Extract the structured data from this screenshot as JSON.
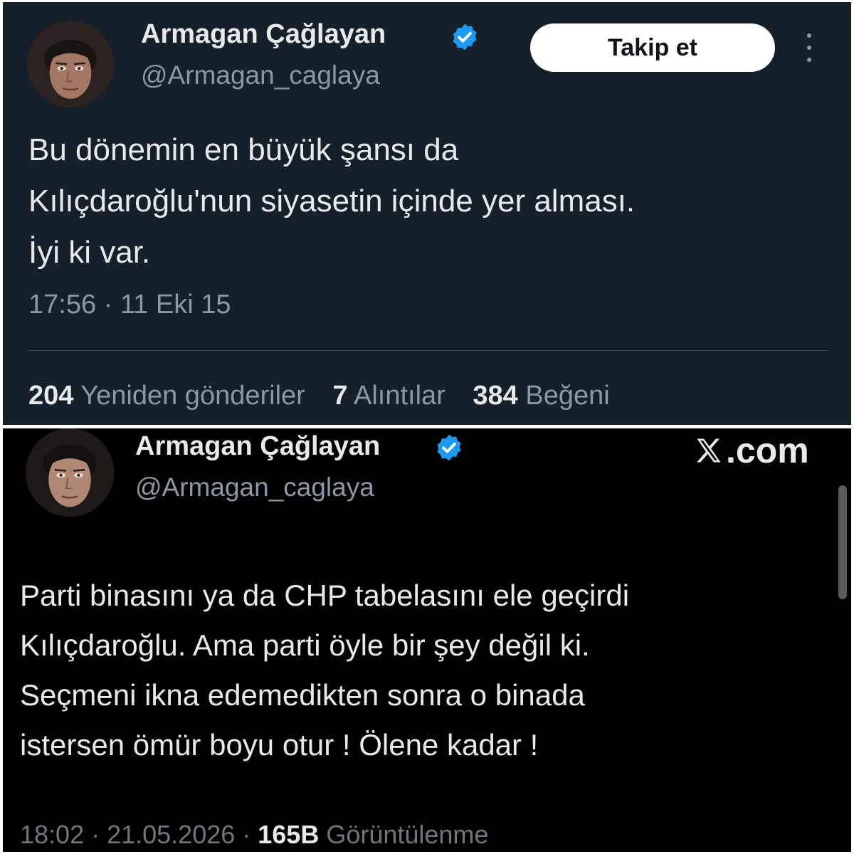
{
  "top_tweet": {
    "author": {
      "name": "Armagan Çağlayan",
      "handle": "@Armagan_caglaya",
      "verified_icon": "verified-badge-icon"
    },
    "follow_button_label": "Takip et",
    "more_icon": "more-vertical-icon",
    "text_lines": [
      "Bu dönemin en büyük şansı da",
      "Kılıçdaroğlu'nun siyasetin içinde yer alması.",
      "İyi ki var."
    ],
    "timestamp": "17:56 · 11 Eki 15",
    "stats": [
      {
        "value": "204",
        "label": "Yeniden gönderiler"
      },
      {
        "value": "7",
        "label": "Alıntılar"
      },
      {
        "value": "384",
        "label": "Beğeni"
      }
    ]
  },
  "bottom_tweet": {
    "author": {
      "name": "Armagan Çağlayan",
      "handle": "@Armagan_caglaya",
      "verified_icon": "verified-badge-icon"
    },
    "brand": {
      "icon": "x-logo-icon",
      "text": ".com"
    },
    "text_lines": [
      "Parti binasını ya da CHP tabelasını ele geçirdi",
      "Kılıçdaroğlu. Ama parti öyle bir şey değil ki.",
      "Seçmeni ikna edemedikten sonra o binada",
      "istersen ömür boyu otur ! Ölene kadar !"
    ],
    "meta": {
      "time_date": "18:02 · 21.05.2026 · ",
      "views_value": "165B",
      "views_label": " Görüntülenme"
    }
  },
  "colors": {
    "top_background": "#15202b",
    "bottom_background": "#000000",
    "verified_blue": "#1d9bf0",
    "primary_text": "#e7e9ea",
    "secondary_text": "#8b98a5"
  }
}
